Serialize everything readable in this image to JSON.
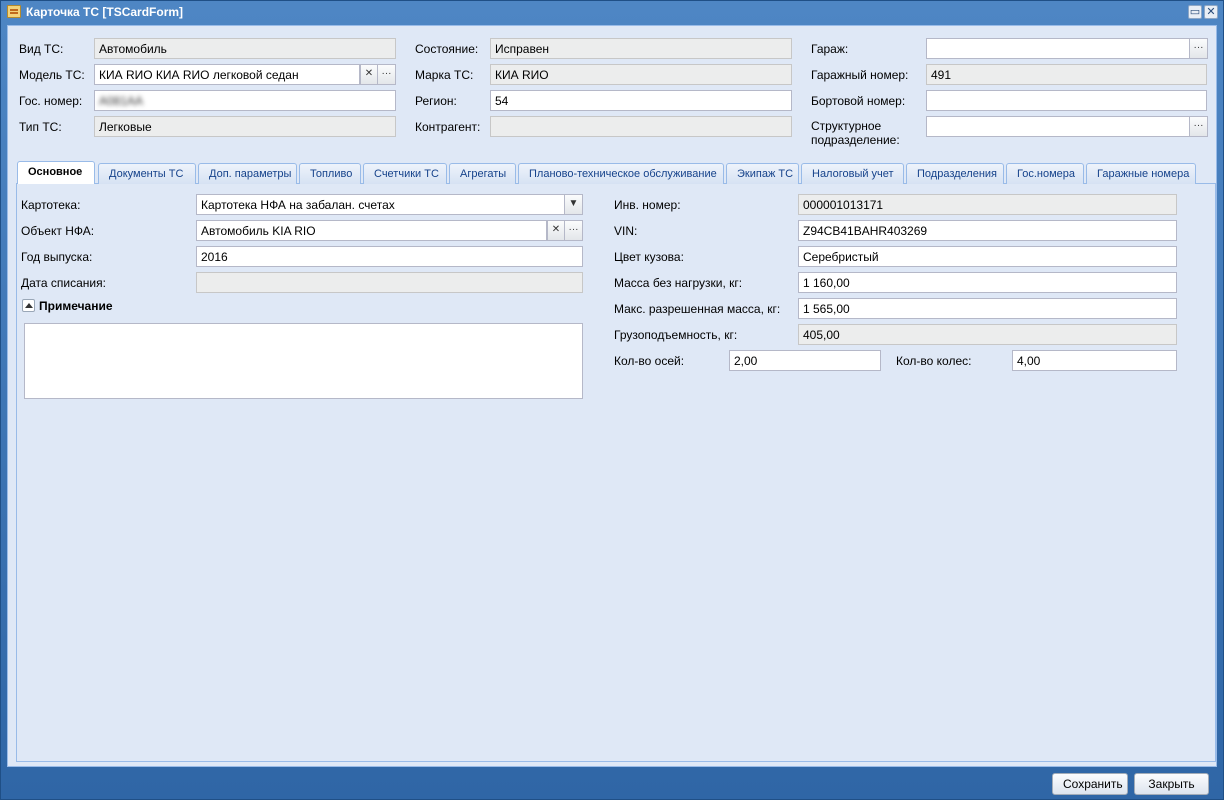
{
  "window": {
    "title": "Карточка ТС [TSCardForm]",
    "icon": "card-form-icon",
    "maximize_glyph": "▭",
    "close_glyph": "✕"
  },
  "header": {
    "vid_ts": {
      "label": "Вид ТС:",
      "value": "Автомобиль"
    },
    "model_ts": {
      "label": "Модель ТС:",
      "value": "КИА RИО КИА RИО легковой седан"
    },
    "gos_nomer": {
      "label": "Гос. номер:",
      "value": "А081АА"
    },
    "tip_ts": {
      "label": "Тип ТС:",
      "value": "Легковые"
    },
    "sostoyanie": {
      "label": "Состояние:",
      "value": "Исправен"
    },
    "marka_ts": {
      "label": "Марка ТС:",
      "value": "КИА RИО"
    },
    "region": {
      "label": "Регион:",
      "value": "54"
    },
    "kontragent": {
      "label": "Контрагент:",
      "value": ""
    },
    "garazh": {
      "label": "Гараж:",
      "value": ""
    },
    "garazhny_nomer": {
      "label": "Гаражный номер:",
      "value": "491"
    },
    "bortovoy_nomer": {
      "label": "Бортовой номер:",
      "value": ""
    },
    "struct_podr": {
      "label": "Структурное подразделение:",
      "value": ""
    }
  },
  "tabs": [
    {
      "label": "Основное",
      "active": true
    },
    {
      "label": "Документы ТС"
    },
    {
      "label": "Доп. параметры"
    },
    {
      "label": "Топливо"
    },
    {
      "label": "Счетчики ТС"
    },
    {
      "label": "Агрегаты"
    },
    {
      "label": "Планово-техническое обслуживание"
    },
    {
      "label": "Экипаж ТС"
    },
    {
      "label": "Налоговый учет"
    },
    {
      "label": "Подразделения"
    },
    {
      "label": "Гос.номера"
    },
    {
      "label": "Гаражные номера"
    }
  ],
  "main": {
    "kartoteka": {
      "label": "Картотека:",
      "value": "Картотека НФА на забалан. счетах"
    },
    "obekt_nfa": {
      "label": "Объект НФА:",
      "value": "Автомобиль KIA RIO"
    },
    "god_vypuska": {
      "label": "Год выпуска:",
      "value": "2016"
    },
    "data_spisaniya": {
      "label": "Дата списания:",
      "value": ""
    },
    "note": {
      "label": "Примечание",
      "value": ""
    },
    "inv_nomer": {
      "label": "Инв. номер:",
      "value": "000001013171"
    },
    "vin": {
      "label": "VIN:",
      "value": "Z94CB41BAHR403269"
    },
    "tsvet": {
      "label": "Цвет кузова:",
      "value": "Серебристый"
    },
    "massa_bez": {
      "label": "Масса без нагрузки, кг:",
      "value": "1 160,00"
    },
    "maks_massa": {
      "label": "Макс. разрешенная масса, кг:",
      "value": "1 565,00"
    },
    "gruzopod": {
      "label": "Грузоподъемность, кг:",
      "value": "405,00"
    },
    "kol_osey": {
      "label": "Кол-во осей:",
      "value": "2,00"
    },
    "kol_koles": {
      "label": "Кол-во колес:",
      "value": "4,00"
    }
  },
  "footer": {
    "save_label": "Сохранить",
    "close_label": "Закрыть"
  },
  "glyphs": {
    "clear": "✕",
    "ellipsis": "···",
    "dropdown": "▼"
  }
}
